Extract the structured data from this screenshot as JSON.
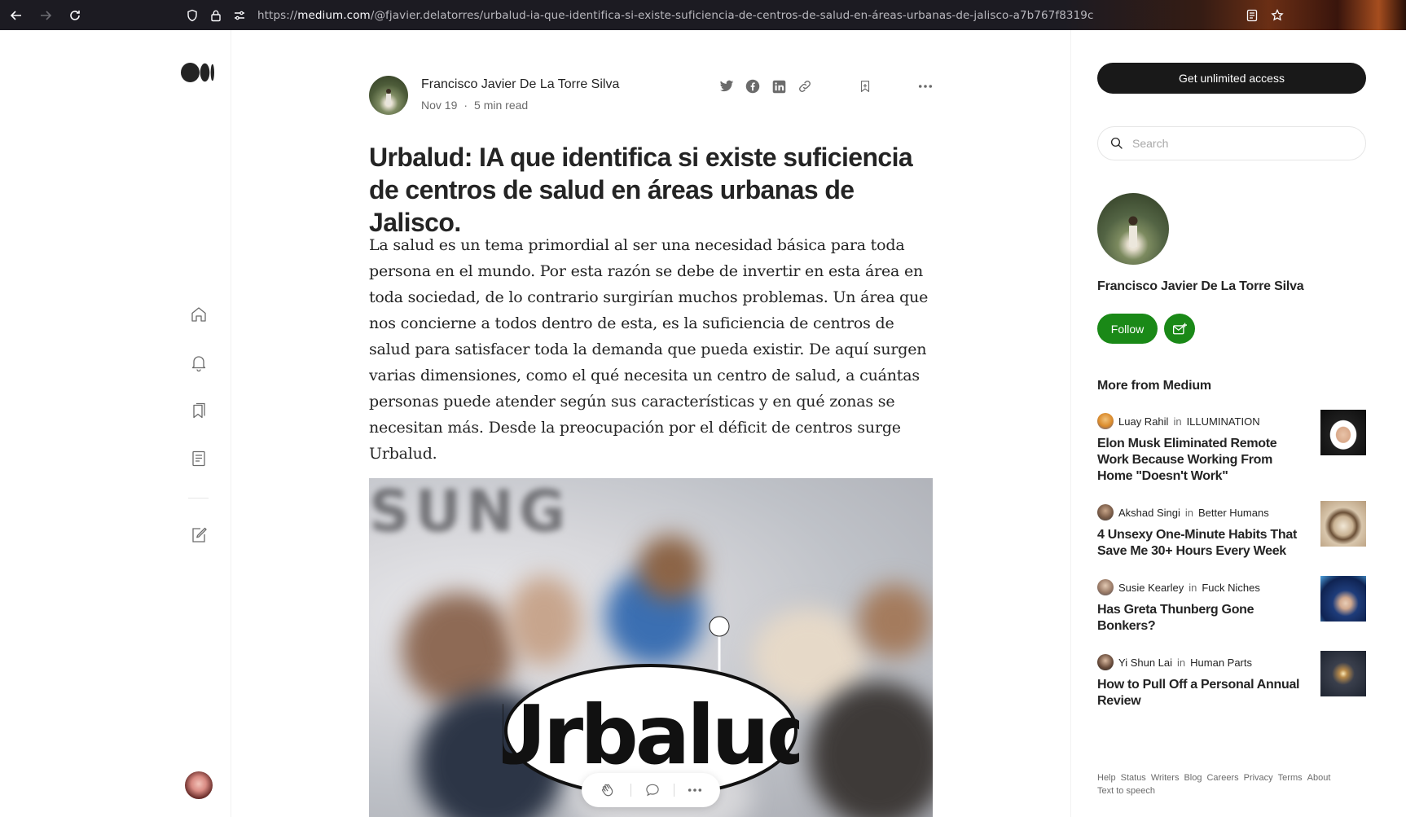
{
  "browser": {
    "url_prefix": "https://",
    "url_host": "medium.com",
    "url_path": "/@fjavier.delatorres/urbalud-ia-que-identifica-si-existe-suficiencia-de-centros-de-salud-en-áreas-urbanas-de-jalisco-a7b767f8319c"
  },
  "article": {
    "author": "Francisco Javier De La Torre Silva",
    "date": "Nov 19",
    "separator": "·",
    "read_time": "5 min read",
    "title": "Urbalud: IA que identifica si existe suficiencia de centros de salud en áreas urbanas de Jalisco.",
    "body": "La salud es un tema primordial al ser una necesidad básica para toda persona en el mundo. Por esta razón se debe de invertir en esta área en toda sociedad, de lo contrario surgirían muchos problemas. Un área que nos concierne a todos dentro de esta, es la suficiencia de centros de salud para satisfacer toda la demanda que pueda existir. De aquí surgen varias dimensiones, como el qué necesita un centro de salud, a cuántas personas puede atender según sus características y en qué zonas se necesitan más. Desde la preocupación por el déficit de centros surge Urbalud.",
    "hero_logo_text": "Urbalud",
    "hero_background_text": "SUNG"
  },
  "sidebar": {
    "get_access_label": "Get unlimited access",
    "search_placeholder": "Search",
    "author_name": "Francisco Javier De La Torre Silva",
    "follow_label": "Follow",
    "more_title": "More from Medium",
    "in_word": "in",
    "recommendations": [
      {
        "author": "Luay Rahil",
        "publication": "ILLUMINATION",
        "title": "Elon Musk Eliminated Remote Work Because Working From Home \"Doesn't Work\""
      },
      {
        "author": "Akshad Singi",
        "publication": "Better Humans",
        "title": "4 Unsexy One-Minute Habits That Save Me 30+ Hours Every Week"
      },
      {
        "author": "Susie Kearley",
        "publication": "Fuck Niches",
        "title": "Has Greta Thunberg Gone Bonkers?"
      },
      {
        "author": "Yi Shun Lai",
        "publication": "Human Parts",
        "title": "How to Pull Off a Personal Annual Review"
      }
    ],
    "footer_links": [
      "Help",
      "Status",
      "Writers",
      "Blog",
      "Careers",
      "Privacy",
      "Terms",
      "About",
      "Text to speech"
    ]
  },
  "icons": {
    "browser": [
      "back-arrow-icon",
      "forward-arrow-icon",
      "reload-icon",
      "shield-icon",
      "lock-icon",
      "permissions-icon",
      "reader-view-icon",
      "bookmark-star-icon"
    ],
    "rail": [
      "medium-logo",
      "home-icon",
      "bell-icon",
      "bookmarks-icon",
      "stories-icon",
      "write-icon"
    ],
    "share": [
      "twitter-icon",
      "facebook-icon",
      "linkedin-icon",
      "link-icon",
      "save-icon",
      "more-icon"
    ],
    "actions": [
      "clap-icon",
      "comment-icon",
      "more-icon"
    ]
  },
  "colors": {
    "follow_green": "#1a8917",
    "text_primary": "#242424",
    "text_secondary": "#6b6b6b",
    "access_button": "#191919",
    "browser_bar": "#1c1b22"
  }
}
